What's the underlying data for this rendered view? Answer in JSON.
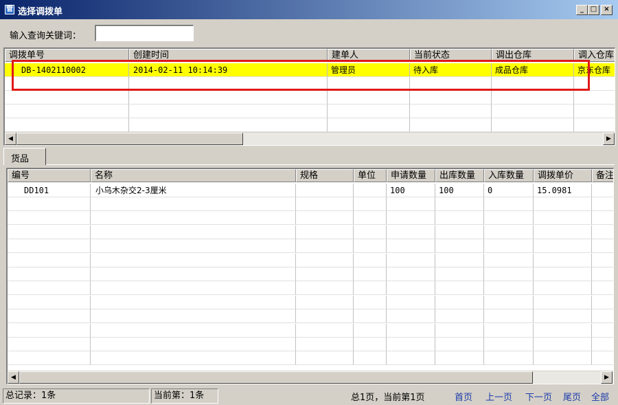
{
  "window": {
    "title_icon": "管",
    "title": "选择调拨单",
    "controls": {
      "minimize": "_",
      "restore": "□",
      "close": "×"
    }
  },
  "search": {
    "label": "输入查询关键词：",
    "value": ""
  },
  "transfer_table": {
    "columns": [
      "调拨单号",
      "创建时间",
      "建单人",
      "当前状态",
      "调出仓库",
      "调入仓库"
    ],
    "rows": [
      [
        "DB-1402110002",
        "2014-02-11 10:14:39",
        "管理员",
        "待入库",
        "成品仓库",
        "京东仓库"
      ]
    ]
  },
  "tab": {
    "label": "货品"
  },
  "goods_table": {
    "columns": [
      "编号",
      "名称",
      "规格",
      "单位",
      "申请数量",
      "出库数量",
      "入库数量",
      "调拨单价",
      "备注"
    ],
    "rows": [
      [
        "DD101",
        "小乌木杂交2-3厘米",
        "",
        "",
        "100",
        "100",
        "0",
        "15.0981",
        ""
      ]
    ]
  },
  "status": {
    "total": "总记录：1条",
    "current": "当前第：1条",
    "pages": "总1页，当前第1页",
    "nav": {
      "first": "首页",
      "prev": "上一页",
      "next": "下一页",
      "last": "尾页",
      "all": "全部"
    }
  },
  "icons": {
    "scroll_left": "left-arrow-icon",
    "scroll_right": "right-arrow-icon"
  },
  "colors": {
    "selected_row": "#ffff00",
    "highlight_box": "#e01818",
    "link": "#1a3aa8"
  }
}
